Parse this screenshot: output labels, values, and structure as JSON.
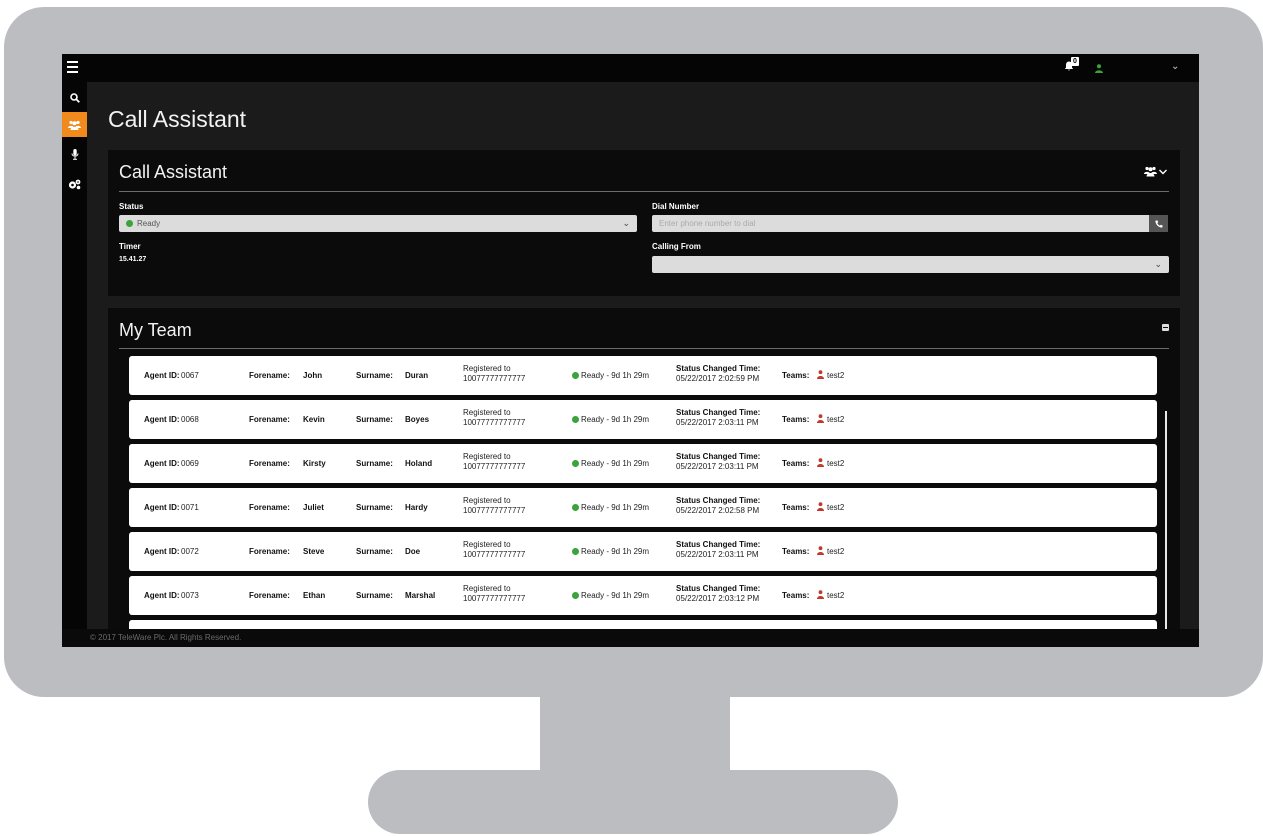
{
  "colors": {
    "accent": "#f08a1c",
    "status_ready": "#3aa43a",
    "team_icon": "#c0392b"
  },
  "topbar": {
    "menu_icon": "hamburger-icon",
    "notification_count": "0",
    "user_icon": "user-icon",
    "user_chevron": "chevron-down-icon"
  },
  "sidebar": {
    "items": [
      {
        "icon": "search-icon",
        "active": false
      },
      {
        "icon": "users-icon",
        "active": true
      },
      {
        "icon": "microphone-icon",
        "active": false
      },
      {
        "icon": "cogs-icon",
        "active": false
      }
    ]
  },
  "page": {
    "title": "Call Assistant"
  },
  "call_assistant": {
    "title": "Call Assistant",
    "status_label": "Status",
    "status_value": "Ready",
    "timer_label": "Timer",
    "timer_value": "15.41.27",
    "dial_label": "Dial Number",
    "dial_placeholder": "Enter phone number to dial",
    "calling_from_label": "Calling From",
    "calling_from_value": ""
  },
  "my_team": {
    "title": "My Team",
    "labels": {
      "agent_id": "Agent ID:",
      "forename": "Forename:",
      "surname": "Surname:",
      "registered_to": "Registered to",
      "status_changed": "Status Changed Time:",
      "teams": "Teams:"
    },
    "agents": [
      {
        "agent_id": "0067",
        "forename": "John",
        "surname": "Duran",
        "registered_number": "10077777777777",
        "status": "Ready - 9d 1h 29m",
        "changed_time": "05/22/2017 2:02:59 PM",
        "team": "test2"
      },
      {
        "agent_id": "0068",
        "forename": "Kevin",
        "surname": "Boyes",
        "registered_number": "10077777777777",
        "status": "Ready - 9d 1h 29m",
        "changed_time": "05/22/2017 2:03:11 PM",
        "team": "test2"
      },
      {
        "agent_id": "0069",
        "forename": "Kirsty",
        "surname": "Holand",
        "registered_number": "10077777777777",
        "status": "Ready - 9d 1h 29m",
        "changed_time": "05/22/2017 2:03:11 PM",
        "team": "test2"
      },
      {
        "agent_id": "0071",
        "forename": "Juliet",
        "surname": "Hardy",
        "registered_number": "10077777777777",
        "status": "Ready - 9d 1h 29m",
        "changed_time": "05/22/2017 2:02:58 PM",
        "team": "test2"
      },
      {
        "agent_id": "0072",
        "forename": "Steve",
        "surname": "Doe",
        "registered_number": "10077777777777",
        "status": "Ready - 9d 1h 29m",
        "changed_time": "05/22/2017 2:03:11 PM",
        "team": "test2"
      },
      {
        "agent_id": "0073",
        "forename": "Ethan",
        "surname": "Marshal",
        "registered_number": "10077777777777",
        "status": "Ready - 9d 1h 29m",
        "changed_time": "05/22/2017 2:03:12 PM",
        "team": "test2"
      },
      {
        "agent_id": "",
        "forename": "",
        "surname": "",
        "registered_number": "",
        "status": "",
        "changed_time": "",
        "team": ""
      }
    ]
  },
  "footer": {
    "copyright": "© 2017 TeleWare Plc. All Rights Reserved."
  }
}
